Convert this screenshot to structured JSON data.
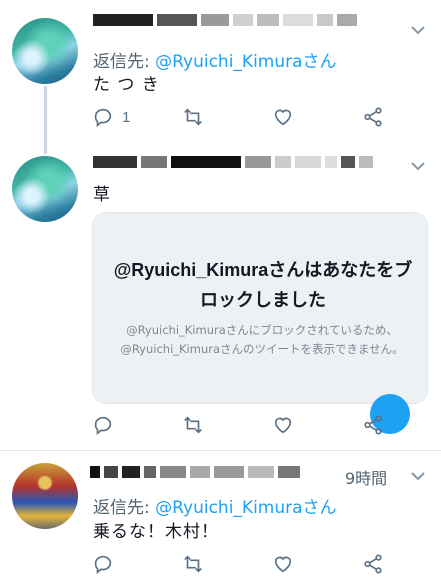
{
  "tweets": [
    {
      "reply_prefix": "返信先: ",
      "reply_handle": "@Ryuichi_Kimuraさん",
      "text": "た つ き",
      "reply_count": "1"
    },
    {
      "text": "草",
      "blocked_card": {
        "title": "@Ryuichi_Kimuraさんはあなたをブロックしました",
        "description": "@Ryuichi_Kimuraさんにブロックされているため、@Ryuichi_Kimuraさんのツイートを表示できません。"
      }
    },
    {
      "time": "9時間",
      "reply_prefix": "返信先: ",
      "reply_handle": "@Ryuichi_Kimuraさん",
      "text": "乗るな！木村！"
    }
  ],
  "colors": {
    "accent": "#1da1f2",
    "muted": "#5b7083"
  },
  "icons": [
    "reply-icon",
    "retweet-icon",
    "like-icon",
    "share-icon",
    "chevron-down-icon"
  ]
}
